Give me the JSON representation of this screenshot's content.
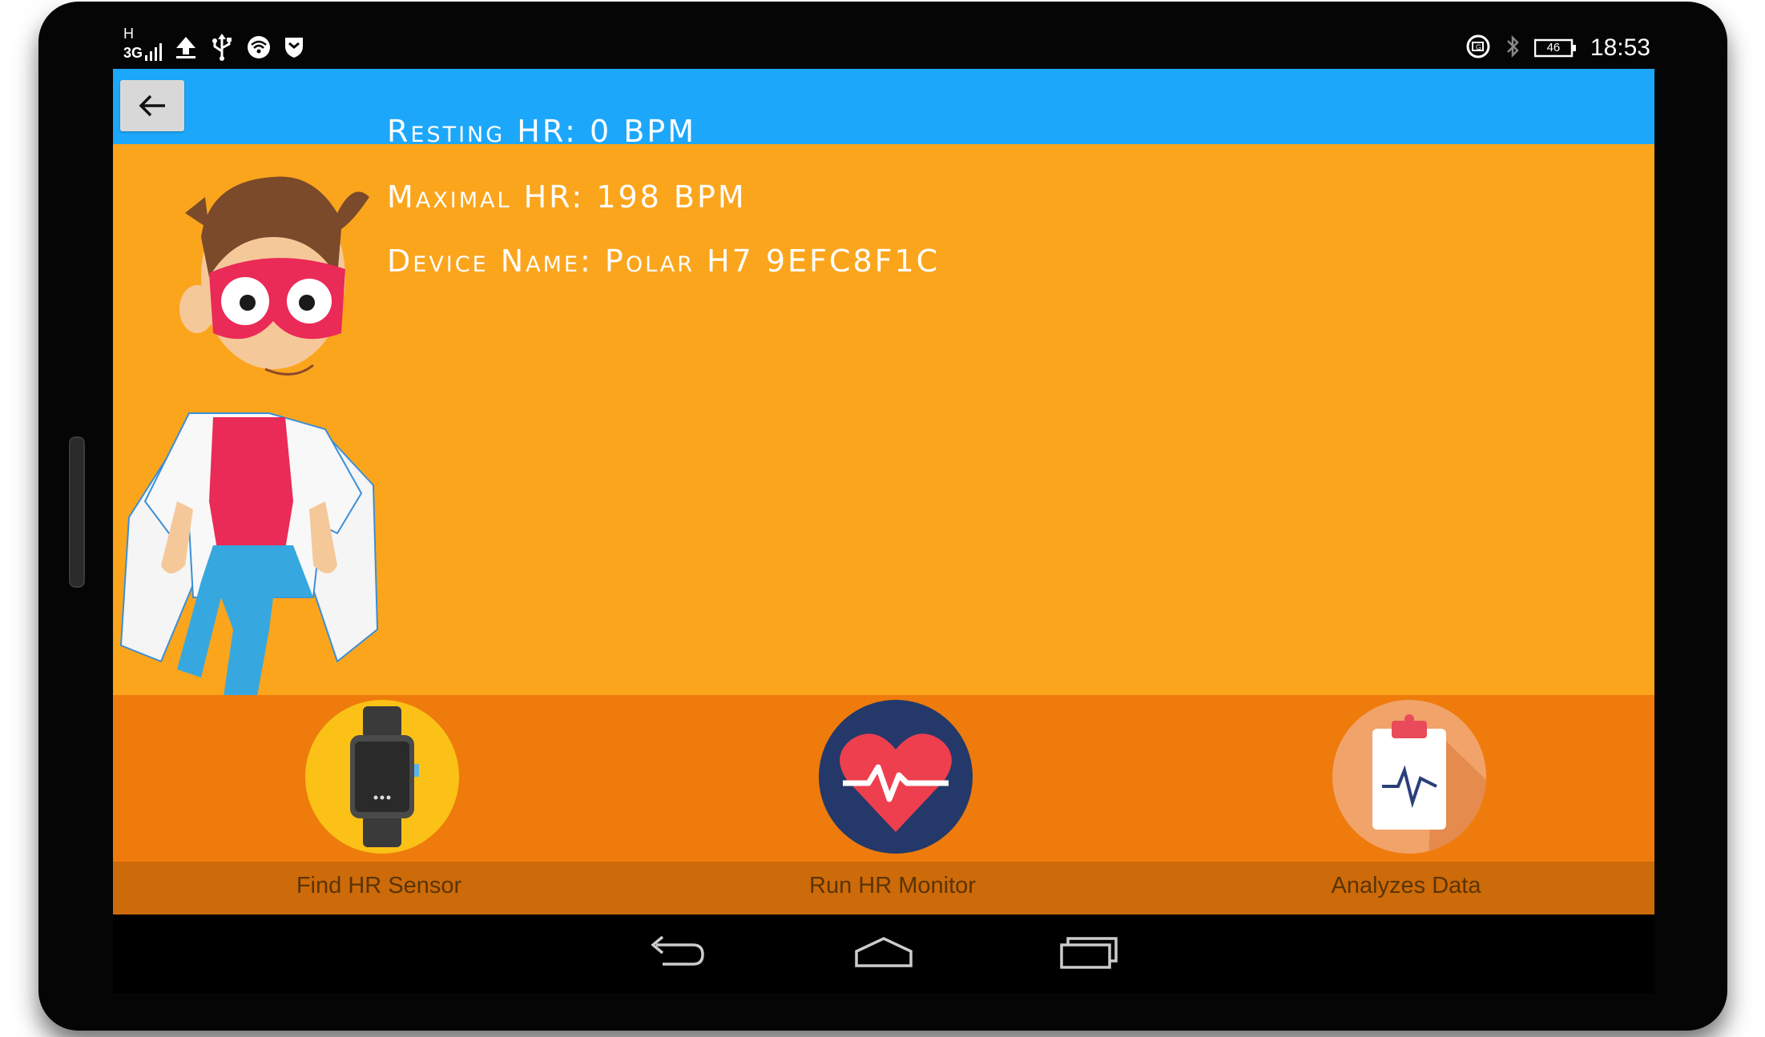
{
  "status_bar": {
    "signal_text": "3G",
    "network_letter": "H",
    "time": "18:53",
    "battery": "46",
    "icons": [
      "signal-icon",
      "upload-icon",
      "usb-icon",
      "wifi-icon",
      "shield-icon",
      "data-saver-icon",
      "bluetooth-icon",
      "battery-icon"
    ]
  },
  "app_bar": {
    "back_icon": "arrow-left-icon",
    "color": "#1da7fa"
  },
  "info": {
    "resting_label": "Resting HR:",
    "resting_value": "0 BPM",
    "maximal_label": "Maximal HR:",
    "maximal_value": "198 BPM",
    "device_label": "Device Name:",
    "device_value": "Polar H7 9EFC8F1C"
  },
  "bottom_nav": [
    {
      "label": "Find HR Sensor",
      "icon": "smartwatch-icon"
    },
    {
      "label": "Run HR Monitor",
      "icon": "heart-pulse-icon"
    },
    {
      "label": "Analyzes Data",
      "icon": "clipboard-chart-icon"
    }
  ],
  "system_nav": {
    "icons": [
      "back-nav-icon",
      "home-nav-icon",
      "recents-nav-icon"
    ]
  },
  "colors": {
    "background": "#fba51d",
    "bottom_bar": "#ee7b0c",
    "label_bar": "#cd6a09",
    "app_bar": "#1da7fa"
  }
}
